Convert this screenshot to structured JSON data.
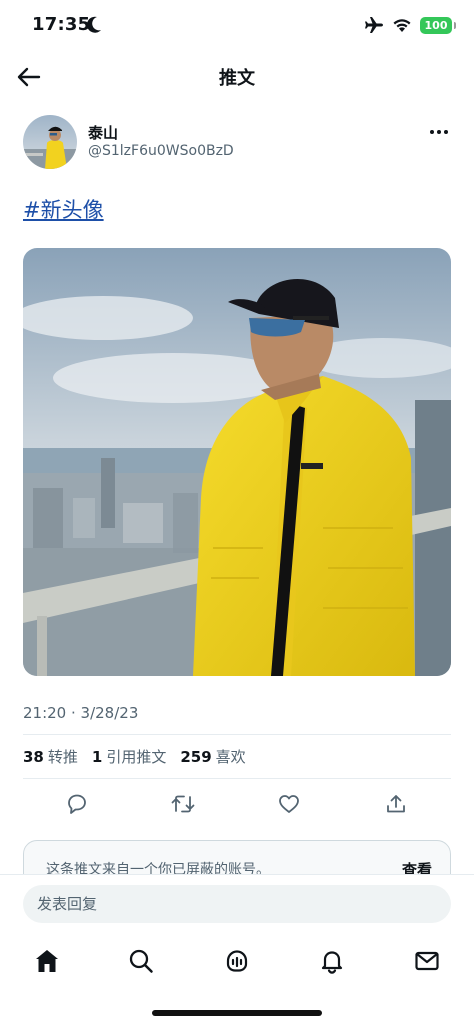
{
  "status_bar": {
    "time": "17:35",
    "battery": "100",
    "icons": [
      "moon-icon",
      "airplane-icon",
      "wifi-icon",
      "battery-icon"
    ]
  },
  "header": {
    "title": "推文",
    "back_icon": "arrow-left-icon"
  },
  "author": {
    "name": "泰山",
    "handle": "@S1lzF6u0WSo0BzD",
    "more_icon": "more-horizontal-icon"
  },
  "tweet": {
    "text": "#新头像",
    "timestamp": "21:20 · 3/28/23"
  },
  "stats": {
    "retweets_count": "38",
    "retweets_label": "转推",
    "quotes_count": "1",
    "quotes_label": "引用推文",
    "likes_count": "259",
    "likes_label": "喜欢"
  },
  "actions": [
    "reply-icon",
    "retweet-icon",
    "like-icon",
    "share-icon"
  ],
  "notice": {
    "text": "这条推文来自一个你已屏蔽的账号。",
    "link": "查看"
  },
  "reply": {
    "placeholder": "发表回复"
  },
  "tabs": [
    "home-icon",
    "search-icon",
    "spaces-icon",
    "notifications-icon",
    "messages-icon"
  ],
  "colors": {
    "text": "#0f1419",
    "secondary": "#536471",
    "hashtag": "#1d4fa8",
    "battery": "#34c759",
    "jacket": "#f2d21f"
  }
}
